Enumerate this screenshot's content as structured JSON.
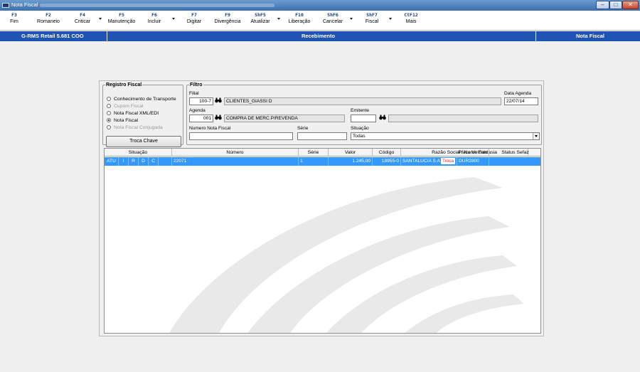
{
  "window": {
    "title": "Nota Fiscal",
    "controls": {
      "minimize": "–",
      "maximize": "□",
      "close": "✕"
    }
  },
  "toolbar": {
    "buttons": [
      {
        "key": "F3",
        "label": "Fim"
      },
      {
        "key": "F2",
        "label": "Romaneio"
      },
      {
        "key": "F4",
        "label": "Criticar"
      },
      {
        "key": "F5",
        "label": "Manutenção"
      },
      {
        "key": "F6",
        "label": "Incluir"
      },
      {
        "key": "F7",
        "label": "Digitar"
      },
      {
        "key": "F9",
        "label": "Divergência"
      },
      {
        "key": "ShF5",
        "label": "Atualizar"
      },
      {
        "key": "F10",
        "label": "Liberação"
      },
      {
        "key": "ShF6",
        "label": "Cancelar"
      },
      {
        "key": "ShF7",
        "label": "Fiscal"
      },
      {
        "key": "CtF12",
        "label": "Mais"
      }
    ]
  },
  "appbar": {
    "version": "G-RMS Retail 5.681 COO",
    "module": "Recebimento",
    "screen": "Nota Fiscal"
  },
  "registro": {
    "title": "Registro Fiscal",
    "options": [
      {
        "label": "Conhecimento de Transporte",
        "enabled": true,
        "selected": false
      },
      {
        "label": "Cupom Fiscal",
        "enabled": false,
        "selected": false
      },
      {
        "label": "Nota Fiscal XML/EDI",
        "enabled": true,
        "selected": false
      },
      {
        "label": "Nota Fiscal",
        "enabled": true,
        "selected": true
      },
      {
        "label": "Nota Fiscal Conjugada",
        "enabled": false,
        "selected": false
      }
    ],
    "troca_chave": "Troca Chave"
  },
  "filtro": {
    "title": "Filtro",
    "filial_label": "Filial",
    "filial_code": "100-7",
    "filial_name": "CLIENTES_GIASSI D",
    "data_agenda_label": "Data Agenda",
    "data_agenda": "22/07/14",
    "agenda_label": "Agenda",
    "agenda_code": "001",
    "agenda_desc": "COMPRA DE MERC.P/REVENDA",
    "emitente_label": "Emitente",
    "emitente_code": "",
    "emitente_name": "",
    "numero_label": "Numero Nota Fiscal",
    "numero": "",
    "serie_label": "Série",
    "serie": "",
    "situacao_label": "Situação",
    "situacao": "Todas"
  },
  "grid": {
    "headers": {
      "situacao": "Situação",
      "numero": "Número",
      "serie": "Série",
      "valor": "Valor",
      "codigo": "Código",
      "razao": "Razão Social / Nome Fantasia",
      "placa": "Placa Veículo",
      "status": "Status Sefaz"
    },
    "rows": [
      {
        "flags": [
          "ATU",
          "I",
          "R",
          "D",
          "C"
        ],
        "numero": "22071",
        "serie": "1",
        "valor": "1.245,00",
        "codigo": "18955-0",
        "razao": "SANTALUCIA S.A",
        "badge": "Troca",
        "placa": "DUR2800",
        "status": ""
      }
    ]
  },
  "colors": {
    "appbar": "#1f54b4",
    "selection": "#3399ff",
    "badge_text": "#e52d2d"
  },
  "icons": {
    "binoculars": "binoculars-icon"
  }
}
